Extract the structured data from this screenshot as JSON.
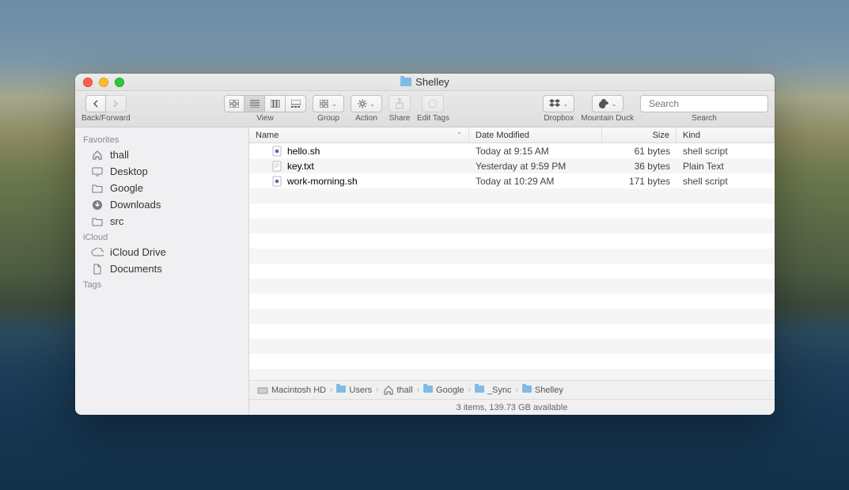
{
  "window": {
    "title": "Shelley"
  },
  "toolbar": {
    "back_forward_label": "Back/Forward",
    "view_label": "View",
    "group_label": "Group",
    "action_label": "Action",
    "share_label": "Share",
    "edit_tags_label": "Edit Tags",
    "dropbox_label": "Dropbox",
    "mountain_duck_label": "Mountain Duck",
    "search_label": "Search",
    "search_placeholder": "Search"
  },
  "sidebar": {
    "sections": [
      {
        "title": "Favorites",
        "items": [
          {
            "icon": "home",
            "label": "thall"
          },
          {
            "icon": "desktop",
            "label": "Desktop"
          },
          {
            "icon": "folder",
            "label": "Google"
          },
          {
            "icon": "download",
            "label": "Downloads"
          },
          {
            "icon": "folder",
            "label": "src"
          }
        ]
      },
      {
        "title": "iCloud",
        "items": [
          {
            "icon": "cloud",
            "label": "iCloud Drive"
          },
          {
            "icon": "doc",
            "label": "Documents"
          }
        ]
      },
      {
        "title": "Tags",
        "items": []
      }
    ]
  },
  "columns": {
    "name": "Name",
    "date": "Date Modified",
    "size": "Size",
    "kind": "Kind"
  },
  "files": [
    {
      "icon": "sh",
      "name": "hello.sh",
      "date": "Today at 9:15 AM",
      "size": "61 bytes",
      "kind": "shell script"
    },
    {
      "icon": "txt",
      "name": "key.txt",
      "date": "Yesterday at 9:59 PM",
      "size": "36 bytes",
      "kind": "Plain Text"
    },
    {
      "icon": "sh",
      "name": "work-morning.sh",
      "date": "Today at 10:29 AM",
      "size": "171 bytes",
      "kind": "shell script"
    }
  ],
  "path": [
    {
      "icon": "hd",
      "label": "Macintosh HD"
    },
    {
      "icon": "folder",
      "label": "Users"
    },
    {
      "icon": "home",
      "label": "thall"
    },
    {
      "icon": "folder",
      "label": "Google"
    },
    {
      "icon": "folder",
      "label": "_Sync"
    },
    {
      "icon": "folder",
      "label": "Shelley"
    }
  ],
  "status": "3 items, 139.73 GB available"
}
